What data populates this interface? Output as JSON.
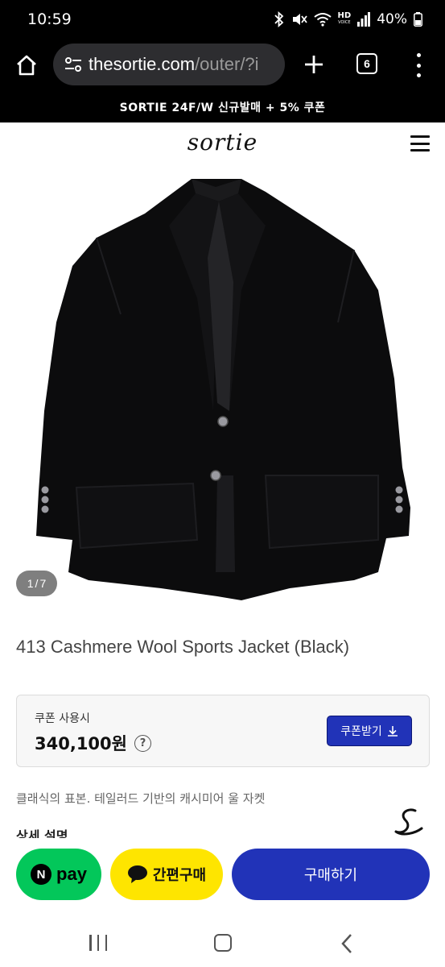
{
  "status_bar": {
    "time": "10:59",
    "battery": "40%",
    "network_badge": "HD",
    "network_badge_sub": "VOICE"
  },
  "browser": {
    "url_domain": "thesortie.com",
    "url_path": "/outer/?i",
    "tab_count": "6"
  },
  "promo_banner": "SORTIE 24F/W 신규발매 + 5% 쿠폰",
  "header": {
    "logo_text": "sortie"
  },
  "product": {
    "image_index": "1",
    "image_separator": "/",
    "image_total": "7",
    "title": "413 Cashmere Wool Sports Jacket (Black)",
    "coupon_label": "쿠폰 사용시",
    "price": "340,100원",
    "help_symbol": "?",
    "coupon_button": "쿠폰받기",
    "summary": "클래식의 표본. 테일러드 기반의 캐시미어 울 자켓",
    "detail_heading": "상세 설명"
  },
  "bottom_bar": {
    "npay_letter": "N",
    "npay_label": "pay",
    "kakao_label": "간편구매",
    "buy_label": "구매하기"
  },
  "colors": {
    "brand_blue": "#2133b8",
    "npay_green": "#03c75a",
    "kakao_yellow": "#fee500"
  }
}
